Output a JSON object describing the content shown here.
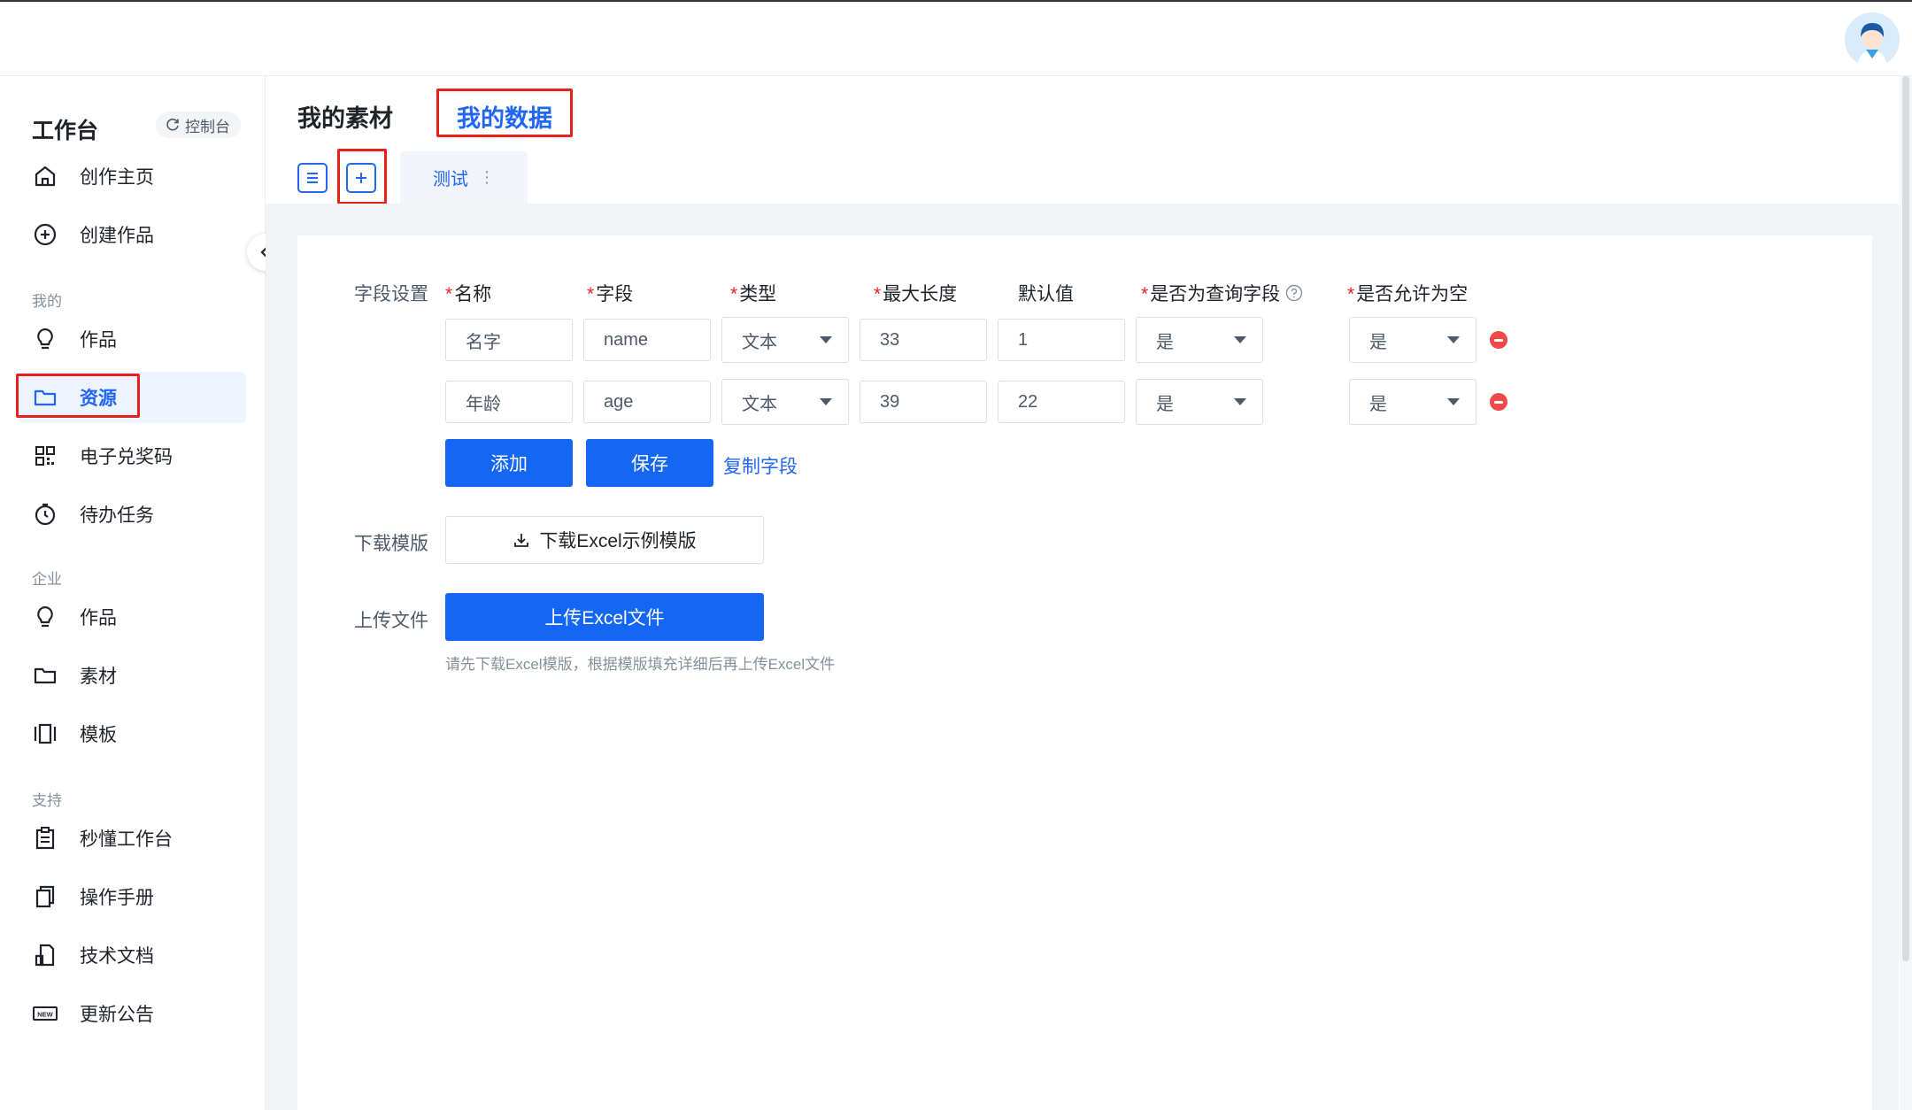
{
  "sidebar": {
    "brand": "工作台",
    "console_label": "控制台",
    "section_mine": "我的",
    "section_enterprise": "企业",
    "section_support": "支持",
    "items": {
      "home": "创作主页",
      "create": "创建作品",
      "works": "作品",
      "resources": "资源",
      "redeem": "电子兑奖码",
      "tasks": "待办任务",
      "ent_works": "作品",
      "materials": "素材",
      "templates": "模板",
      "guide": "秒懂工作台",
      "manual": "操作手册",
      "tech_docs": "技术文档",
      "updates": "更新公告"
    },
    "active_item": "资源"
  },
  "header": {
    "tab_materials": "我的素材",
    "tab_data": "我的数据",
    "active_tab": "我的数据",
    "subtab_label": "测试"
  },
  "form": {
    "field_settings_label": "字段设置",
    "columns": {
      "name": "名称",
      "field": "字段",
      "type": "类型",
      "max_length": "最大长度",
      "default": "默认值",
      "is_query": "是否为查询字段",
      "allow_null": "是否允许为空"
    },
    "rows": [
      {
        "name": "名字",
        "field": "name",
        "type": "文本",
        "max_length": "33",
        "default": "1",
        "is_query": "是",
        "allow_null": "是"
      },
      {
        "name": "年龄",
        "field": "age",
        "type": "文本",
        "max_length": "39",
        "default": "22",
        "is_query": "是",
        "allow_null": "是"
      }
    ],
    "add_label": "添加",
    "save_label": "保存",
    "copy_fields_label": "复制字段",
    "download_label": "下载模版",
    "download_button": "下载Excel示例模版",
    "upload_label": "上传文件",
    "upload_button": "上传Excel文件",
    "upload_hint": "请先下载Excel模版，根据模版填充详细后再上传Excel文件"
  },
  "colors": {
    "primary": "#1467f5",
    "link": "#2166f5",
    "danger": "#f04848",
    "highlight_outline": "#e5211c"
  }
}
